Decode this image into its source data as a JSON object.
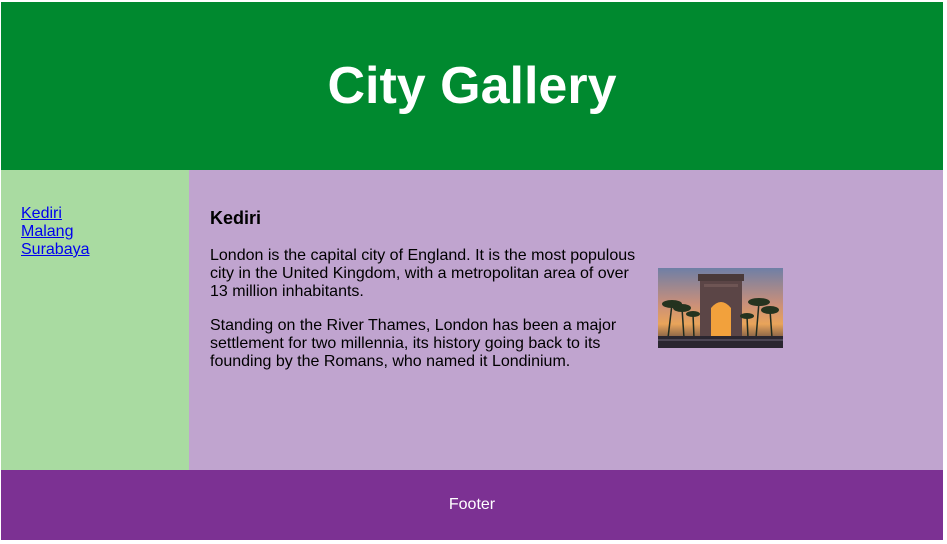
{
  "header": {
    "title": "City Gallery"
  },
  "nav": {
    "links": [
      {
        "label": "Kediri"
      },
      {
        "label": "Malang"
      },
      {
        "label": "Surabaya"
      }
    ]
  },
  "main": {
    "heading": "Kediri",
    "paragraphs": [
      "London is the capital city of England. It is the most populous city in the United Kingdom, with a metropolitan area of over 13 million inhabitants.",
      "Standing on the River Thames, London has been a major settlement for two millennia, its history going back to its founding by the Romans, who named it Londinium."
    ],
    "image": {
      "subject": "arch-monument-at-sunset"
    }
  },
  "footer": {
    "text": "Footer"
  },
  "colors": {
    "header_bg": "#00892f",
    "nav_bg": "#a9dba1",
    "main_bg": "#c0a4cf",
    "footer_bg": "#7c3193",
    "link": "#0000ee"
  }
}
